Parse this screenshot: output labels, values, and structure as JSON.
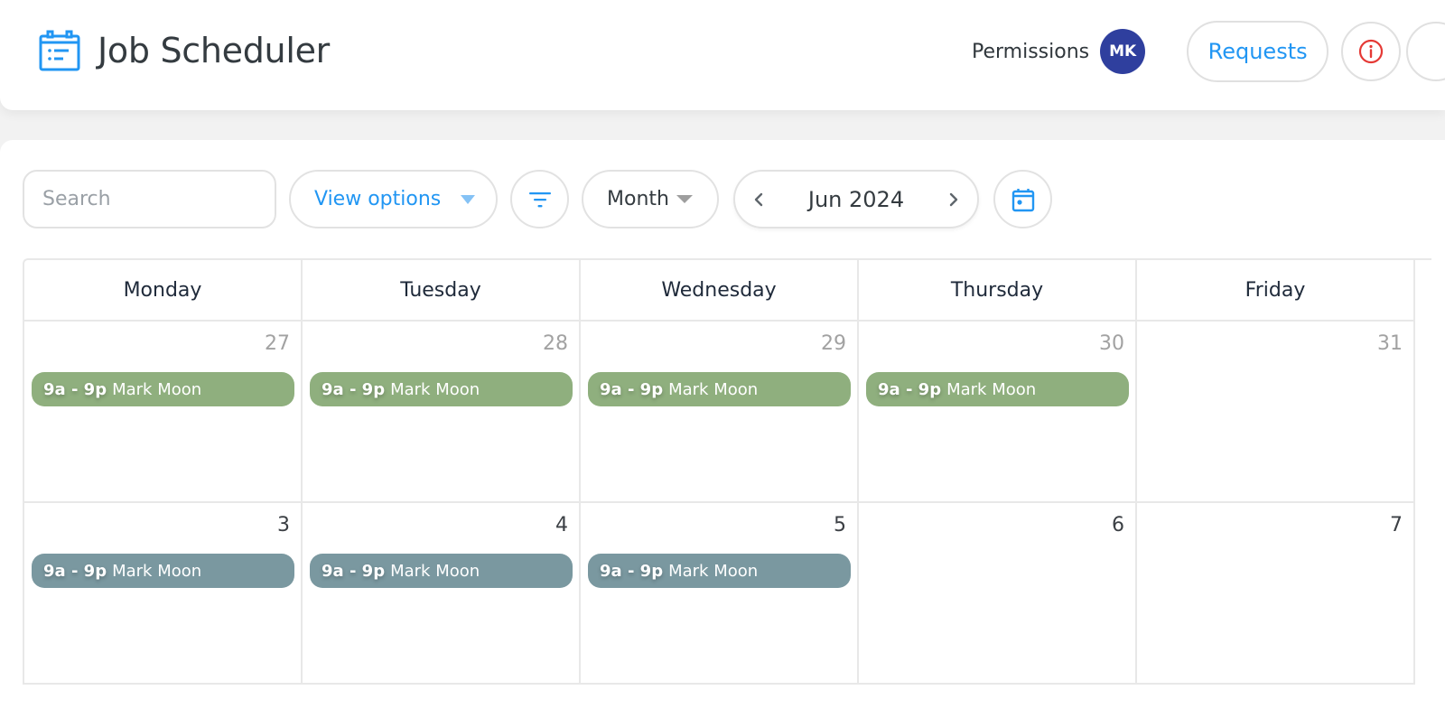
{
  "header": {
    "app_title": "Job Scheduler",
    "app_icon": "calendar-list-icon",
    "permissions_label": "Permissions",
    "avatar_initials": "MK",
    "requests_label": "Requests",
    "info_icon": "info-icon"
  },
  "toolbar": {
    "search_placeholder": "Search",
    "search_value": "",
    "view_options_label": "View options",
    "filter_icon": "filter-icon",
    "view_mode": "Month",
    "current_period": "Jun 2024",
    "prev_icon": "chevron-left-icon",
    "next_icon": "chevron-right-icon",
    "today_icon": "calendar-today-icon"
  },
  "colors": {
    "accent": "#2196f3",
    "avatar_bg": "#2f3f9e",
    "info_red": "#e53935",
    "event_green": "#8faf7e",
    "event_slate": "#7a98a0"
  },
  "calendar": {
    "weekdays": [
      "Monday",
      "Tuesday",
      "Wednesday",
      "Thursday",
      "Friday"
    ],
    "weeks": [
      {
        "days": [
          {
            "date": "27",
            "other_month": true,
            "events": [
              {
                "time": "9a - 9p",
                "name": "Mark Moon",
                "color": "#8faf7e"
              }
            ]
          },
          {
            "date": "28",
            "other_month": true,
            "events": [
              {
                "time": "9a - 9p",
                "name": "Mark Moon",
                "color": "#8faf7e"
              }
            ]
          },
          {
            "date": "29",
            "other_month": true,
            "events": [
              {
                "time": "9a - 9p",
                "name": "Mark Moon",
                "color": "#8faf7e"
              }
            ]
          },
          {
            "date": "30",
            "other_month": true,
            "events": [
              {
                "time": "9a - 9p",
                "name": "Mark Moon",
                "color": "#8faf7e"
              }
            ]
          },
          {
            "date": "31",
            "other_month": true,
            "events": []
          }
        ]
      },
      {
        "days": [
          {
            "date": "3",
            "other_month": false,
            "events": [
              {
                "time": "9a - 9p",
                "name": "Mark Moon",
                "color": "#7a98a0"
              }
            ]
          },
          {
            "date": "4",
            "other_month": false,
            "events": [
              {
                "time": "9a - 9p",
                "name": "Mark Moon",
                "color": "#7a98a0"
              }
            ]
          },
          {
            "date": "5",
            "other_month": false,
            "events": [
              {
                "time": "9a - 9p",
                "name": "Mark Moon",
                "color": "#7a98a0"
              }
            ]
          },
          {
            "date": "6",
            "other_month": false,
            "events": []
          },
          {
            "date": "7",
            "other_month": false,
            "events": []
          }
        ]
      }
    ]
  }
}
